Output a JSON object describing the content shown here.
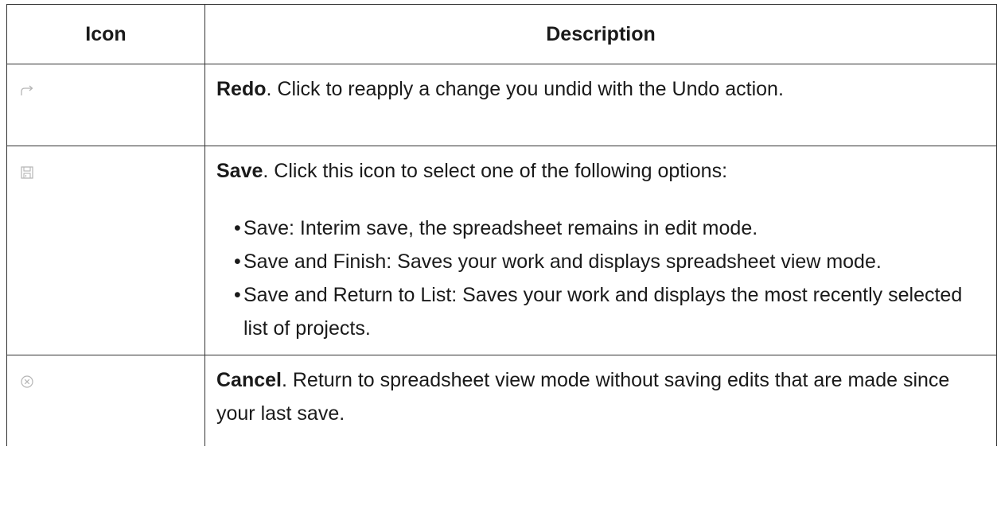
{
  "table": {
    "headers": {
      "icon": "Icon",
      "description": "Description"
    },
    "rows": [
      {
        "icon": "redo-icon",
        "title": "Redo",
        "text": ". Click to reapply a change you undid with the Undo action."
      },
      {
        "icon": "save-icon",
        "title": "Save",
        "text": ". Click this icon to select one of the following options:",
        "options": [
          "Save: Interim save, the spreadsheet remains in edit mode.",
          "Save and Finish: Saves your work and displays spreadsheet view mode.",
          "Save and Return to List: Saves your work and displays the most recently selected list of projects."
        ]
      },
      {
        "icon": "cancel-icon",
        "title": "Cancel",
        "text": ". Return to spreadsheet view mode without saving edits that are made since your last save."
      }
    ]
  },
  "colors": {
    "border": "#333333",
    "icon": "#b5b5b5",
    "text": "#1a1a1a"
  }
}
